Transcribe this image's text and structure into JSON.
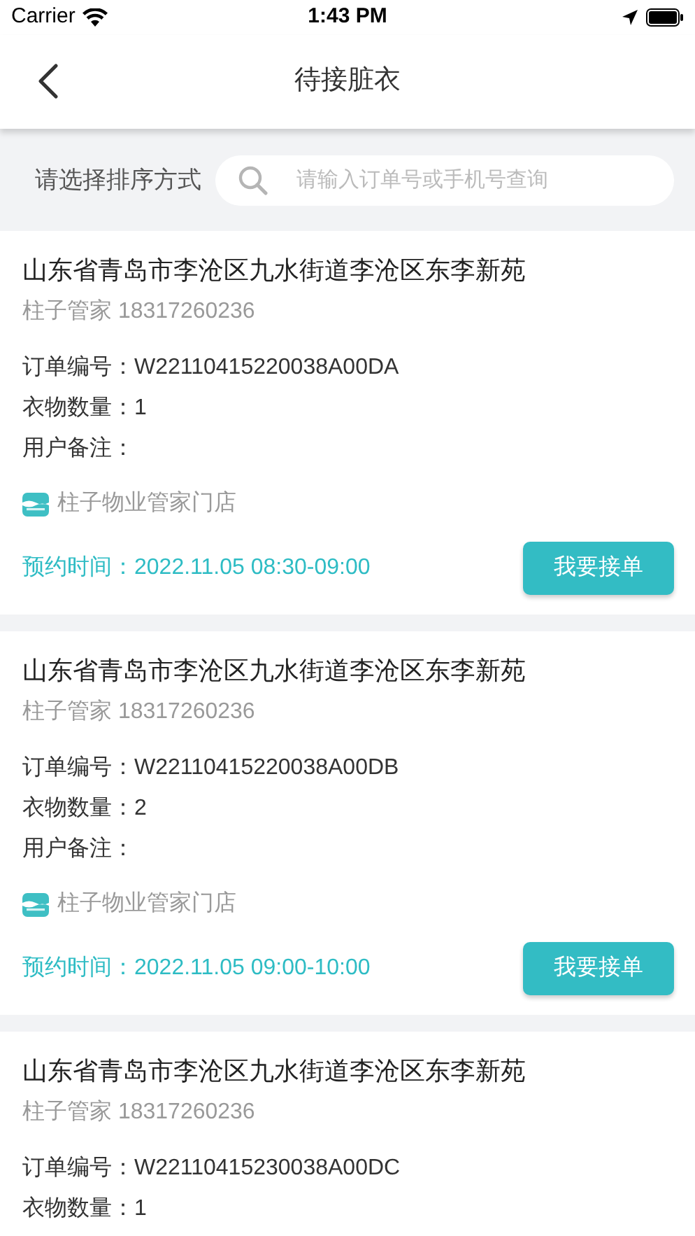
{
  "status_bar": {
    "carrier": "Carrier",
    "time": "1:43 PM"
  },
  "nav": {
    "title": "待接脏衣"
  },
  "filter": {
    "sort_label": "请选择排序方式",
    "search_placeholder": "请输入订单号或手机号查询"
  },
  "orders": [
    {
      "address": "山东省青岛市李沧区九水街道李沧区东李新苑",
      "contact": "柱子管家 18317260236",
      "order_no": "订单编号：W22110415220038A00DA",
      "quantity": "衣物数量：1",
      "remark": "用户备注：",
      "store": "柱子物业管家门店",
      "appointment": "预约时间：2022.11.05 08:30-09:00",
      "action": "我要接单"
    },
    {
      "address": "山东省青岛市李沧区九水街道李沧区东李新苑",
      "contact": "柱子管家 18317260236",
      "order_no": "订单编号：W22110415220038A00DB",
      "quantity": "衣物数量：2",
      "remark": "用户备注：",
      "store": "柱子物业管家门店",
      "appointment": "预约时间：2022.11.05 09:00-10:00",
      "action": "我要接单"
    },
    {
      "address": "山东省青岛市李沧区九水街道李沧区东李新苑",
      "contact": "柱子管家 18317260236",
      "order_no": "订单编号：W22110415230038A00DC",
      "quantity": "衣物数量：1"
    }
  ]
}
